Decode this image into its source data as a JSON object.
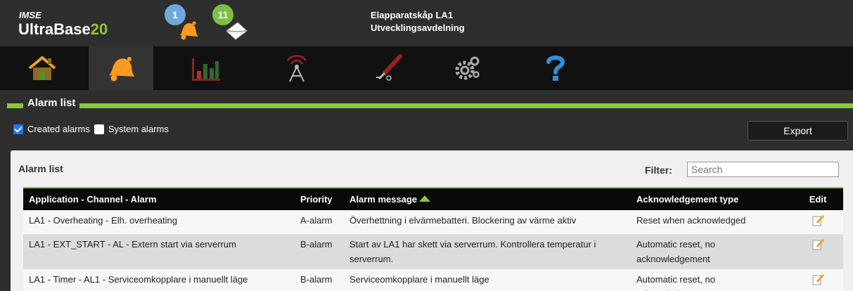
{
  "header": {
    "brand_small": "IMSE",
    "brand_name": "UltraBase",
    "brand_number": "20",
    "alarm_count": "1",
    "message_count": "11",
    "site_line1": "Elapparatskåp LA1",
    "site_line2": "Utvecklingsavdelning"
  },
  "nav": {
    "items": [
      "home-icon",
      "alarm-bell-icon",
      "chart-icon",
      "antenna-icon",
      "tools-icon",
      "settings-gears-icon",
      "help-icon"
    ],
    "active": "alarm-bell-icon"
  },
  "section": {
    "title": "Alarm list"
  },
  "filters": {
    "created_alarms": "Created alarms",
    "system_alarms": "System alarms",
    "export_label": "Export"
  },
  "panel": {
    "title": "Alarm list",
    "filter_label": "Filter:",
    "filter_placeholder": "Search"
  },
  "table": {
    "headers": {
      "channel": "Application - Channel - Alarm",
      "priority": "Priority",
      "message": "Alarm message",
      "ack": "Acknowledgement type",
      "edit": "Edit"
    },
    "rows": [
      {
        "channel": "LA1 - Overheating - Elh. overheating",
        "priority": "A-alarm",
        "message": "Överhettning i elvärmebatteri. Blockering av värme aktiv",
        "ack": "Reset when acknowledged"
      },
      {
        "channel": "LA1 - EXT_START - AL - Extern start via serverrum",
        "priority": "B-alarm",
        "message": "Start av LA1 har skett via serverrum. Kontrollera temperatur i serverrum.",
        "ack": "Automatic reset, no acknowledgement"
      },
      {
        "channel": "LA1 - Timer - AL1 - Serviceomkopplare i manuellt läge",
        "priority": "B-alarm",
        "message": "Serviceomkopplare i manuellt läge",
        "ack": "Automatic reset, no acknowledgement"
      }
    ]
  },
  "colors": {
    "accent": "#8dc63f",
    "badge_blue": "#6fa8dc",
    "badge_green": "#7ac142",
    "bell_orange": "#ff9a1f"
  }
}
